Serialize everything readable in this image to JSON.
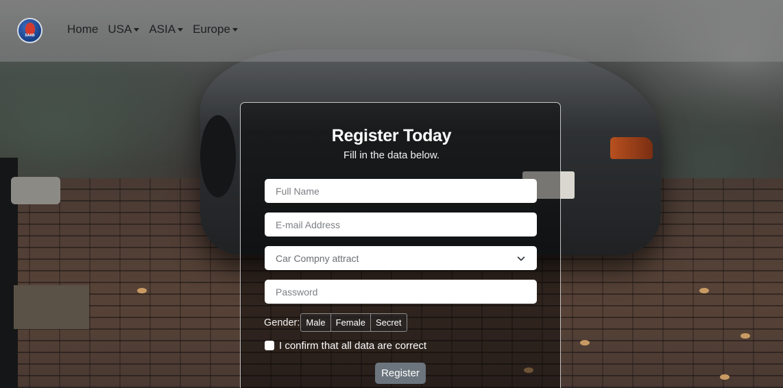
{
  "brand": {
    "text": "SAAB",
    "icon": "saab-griffin-logo"
  },
  "nav": {
    "items": [
      {
        "label": "Home",
        "dropdown": false
      },
      {
        "label": "USA",
        "dropdown": true
      },
      {
        "label": "ASIA",
        "dropdown": true
      },
      {
        "label": "Europe",
        "dropdown": true
      }
    ]
  },
  "form": {
    "title": "Register Today",
    "subtitle": "Fill in the data below.",
    "full_name_placeholder": "Full Name",
    "email_placeholder": "E-mail Address",
    "company_select_value": "Car Compny attract",
    "password_placeholder": "Password",
    "gender_label": "Gender:",
    "gender_options": [
      "Male",
      "Female",
      "Secret"
    ],
    "confirm_label": "I confirm that all data are correct",
    "register_label": "Register"
  },
  "colors": {
    "navbar": "#8c8c8c",
    "register_button": "#6c757d",
    "card_border": "#ffffff"
  }
}
